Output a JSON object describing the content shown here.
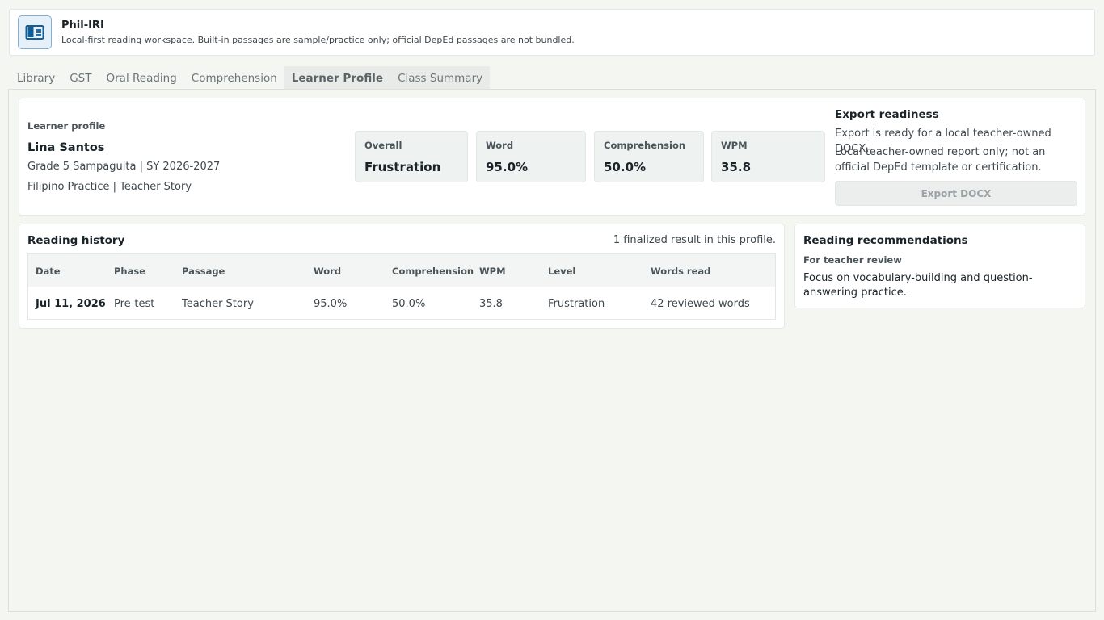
{
  "app": {
    "title": "Phil-IRI",
    "subtitle": "Local-first reading workspace. Built-in passages are sample/practice only; official DepEd passages are not bundled.",
    "logo_icon": "book-reader-icon",
    "accent": "#0f5e9c"
  },
  "tabs": [
    {
      "label": "Library",
      "active": false
    },
    {
      "label": "GST",
      "active": false
    },
    {
      "label": "Oral Reading",
      "active": false
    },
    {
      "label": "Comprehension",
      "active": false
    },
    {
      "label": "Learner Profile",
      "active": true
    },
    {
      "label": "Class Summary",
      "active": false
    }
  ],
  "profile": {
    "eyebrow": "Learner profile",
    "name": "Lina Santos",
    "class_line": "Grade 5 Sampaguita | SY 2026-2027",
    "passage_line": "Filipino Practice | Teacher Story",
    "stats": [
      {
        "label": "Overall",
        "value": "Frustration"
      },
      {
        "label": "Word",
        "value": "95.0%"
      },
      {
        "label": "Comprehension",
        "value": "50.0%"
      },
      {
        "label": "WPM",
        "value": "35.8"
      }
    ]
  },
  "export": {
    "title": "Export readiness",
    "status": "Export is ready for a local teacher-owned DOCX.",
    "note": "Local teacher-owned report only; not an official DepEd template or certification.",
    "button_label": "Export DOCX"
  },
  "history": {
    "title": "Reading history",
    "count_text": "1 finalized result in this profile.",
    "columns": [
      "Date",
      "Phase",
      "Passage",
      "Word",
      "Comprehension",
      "WPM",
      "Level",
      "Words read"
    ],
    "rows": [
      [
        "Jul 11, 2026",
        "Pre-test",
        "Teacher Story",
        "95.0%",
        "50.0%",
        "35.8",
        "Frustration",
        "42 reviewed words"
      ]
    ]
  },
  "recommendations": {
    "title": "Reading recommendations",
    "subtitle": "For teacher review",
    "text": "Focus on vocabulary-building and question-answering practice."
  }
}
